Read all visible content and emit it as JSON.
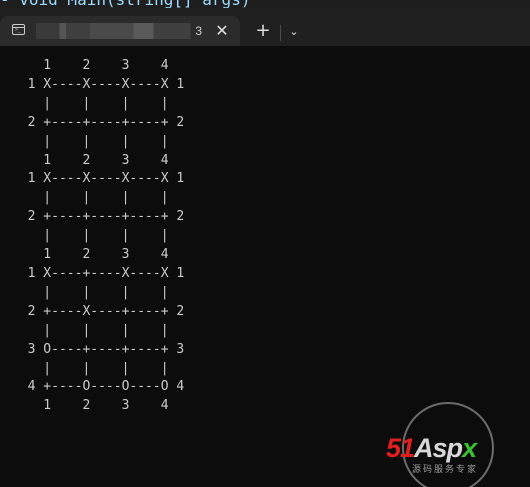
{
  "background_window": {
    "code_fragment": "- void Main(string[] args)"
  },
  "tab": {
    "icon": "terminal-icon",
    "icon_prompt": ">_",
    "title_visible_suffix": "3",
    "close_icon": "close-icon"
  },
  "tab_bar": {
    "new_tab_icon": "plus-icon",
    "new_tab_glyph": "+",
    "dropdown_icon": "chevron-down-icon",
    "dropdown_glyph": "⌄",
    "close_glyph": "✕"
  },
  "terminal": {
    "lines": [
      "    1    2    3    4",
      "  1 X----X----X----X 1",
      "    |    |    |    |",
      "  2 +----+----+----+ 2",
      "    |    |    |    |",
      "    1    2    3    4",
      "  1 X----X----X----X 1",
      "    |    |    |    |",
      "  2 +----+----+----+ 2",
      "    |    |    |    |",
      "    1    2    3    4",
      "  1 X----+----X----X 1",
      "    |    |    |    |",
      "  2 +----X----+----+ 2",
      "    |    |    |    |",
      "  3 O----+----+----+ 3",
      "    |    |    |    |",
      "  4 +----O----O----O 4",
      "    1    2    3    4"
    ]
  },
  "watermark": {
    "logo_number": "51",
    "logo_word": "Asp",
    "logo_x": "x",
    "tagline": "源码服务专家"
  },
  "colors": {
    "terminal_bg": "#0c0c0c",
    "terminal_text": "#cccccc",
    "tab_bar_bg": "#202020",
    "active_tab_bg": "#2b2b2b",
    "logo_red": "#e02020",
    "logo_green": "#3bbf2e"
  }
}
